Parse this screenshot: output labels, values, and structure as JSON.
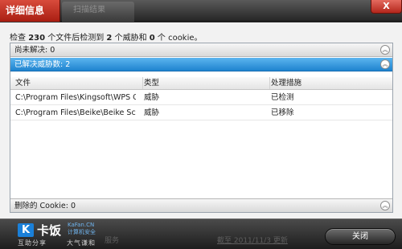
{
  "window": {
    "active_tab": "详细信息",
    "inactive_tab": "扫描结果",
    "close_glyph": "X"
  },
  "summary": {
    "prefix": "检查 ",
    "files_checked": "230",
    "mid": " 个文件后检测到 ",
    "threats_detected": "2",
    "mid2": " 个威胁和 ",
    "cookies": "0",
    "suffix": " 个 cookie。"
  },
  "sections": {
    "unresolved": {
      "label": "尚未解决: 0"
    },
    "resolved": {
      "label": "已解决威胁数: 2"
    },
    "cookies_deleted": {
      "label": "删除的 Cookie: 0"
    }
  },
  "table": {
    "columns": [
      "文件",
      "类型",
      "处理措施"
    ],
    "rows": [
      {
        "file": "C:\\Program Files\\Kingsoft\\WPS Offi...",
        "type": "威胁",
        "action": "已检测"
      },
      {
        "file": "C:\\Program Files\\Beike\\Beike Scan\\...",
        "type": "威胁",
        "action": "已移除"
      }
    ]
  },
  "footer": {
    "logo_mark": "K",
    "logo_name": "卡饭",
    "logo_site_line1": "KaFan.CN",
    "logo_site_line2": "计算机安全",
    "slogan_left": "互助分享",
    "slogan_right": "大气谦和",
    "ghost_left": "服务",
    "ghost_right": "截至 2011/11/3 更新",
    "close_button": "关闭"
  },
  "icons": {
    "collapse": "double-chevron-up-icon"
  }
}
